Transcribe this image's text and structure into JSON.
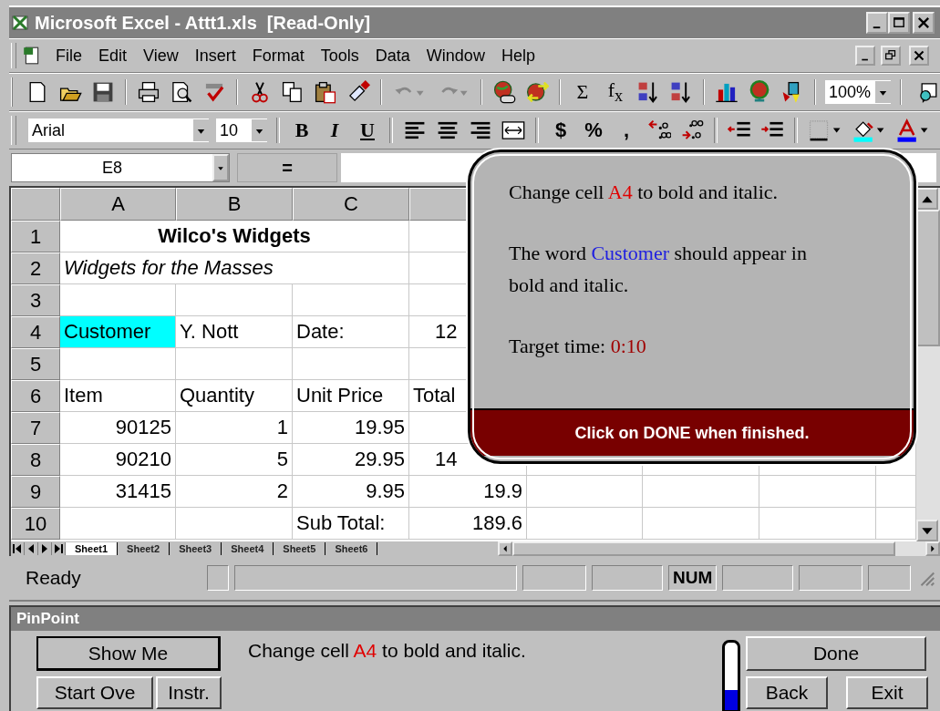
{
  "window": {
    "title": "Microsoft Excel - Attt1.xls  [Read-Only]"
  },
  "menu": [
    "File",
    "Edit",
    "View",
    "Insert",
    "Format",
    "Tools",
    "Data",
    "Window",
    "Help"
  ],
  "standard_toolbar": {
    "buttons": [
      {
        "label": "Σ"
      },
      {
        "label": "f$_{x}$"
      }
    ],
    "zoom": "100%"
  },
  "formatting_toolbar": {
    "font": "Arial",
    "size": "10",
    "buttons": [
      {
        "label": "B",
        "kind": "bold"
      },
      {
        "label": "I",
        "kind": "italic"
      },
      {
        "label": "U",
        "kind": "underline"
      }
    ],
    "number_buttons": [
      {
        "label": "$"
      },
      {
        "label": "%"
      },
      {
        "label": ","
      }
    ]
  },
  "formula_bar": {
    "name_box": "E8",
    "equals": "="
  },
  "sheet": {
    "columns": [
      "A",
      "B",
      "C"
    ],
    "rows": [
      {
        "label": "1",
        "cells": [
          {
            "text": "Wilco's Widgets",
            "kind": "title",
            "highlighted": false
          }
        ]
      },
      {
        "label": "2",
        "cells": [
          {
            "text": "Widgets for the Masses",
            "kind": "subtitle",
            "highlighted": false
          }
        ]
      },
      {
        "label": "3",
        "cells": []
      },
      {
        "label": "4",
        "cells": [
          {
            "text": "Customer",
            "kind": "text",
            "highlighted": true
          },
          {
            "text": "Y. Nott",
            "kind": "text",
            "highlighted": false
          },
          {
            "text": "Date:",
            "kind": "text",
            "highlighted": false
          },
          {
            "text": "12",
            "kind": "clipped",
            "highlighted": false
          }
        ]
      },
      {
        "label": "5",
        "cells": []
      },
      {
        "label": "6",
        "cells": [
          {
            "text": "Item",
            "kind": "text",
            "highlighted": false
          },
          {
            "text": "Quantity",
            "kind": "text",
            "highlighted": false
          },
          {
            "text": "Unit Price",
            "kind": "text",
            "highlighted": false
          },
          {
            "text": "Total",
            "kind": "text",
            "highlighted": false
          }
        ]
      },
      {
        "label": "7",
        "cells": [
          {
            "text": "90125",
            "kind": "number",
            "highlighted": false
          },
          {
            "text": "1",
            "kind": "number",
            "highlighted": false
          },
          {
            "text": "19.95",
            "kind": "number",
            "highlighted": false
          }
        ]
      },
      {
        "label": "8",
        "cells": [
          {
            "text": "90210",
            "kind": "number",
            "highlighted": false
          },
          {
            "text": "5",
            "kind": "number",
            "highlighted": false
          },
          {
            "text": "29.95",
            "kind": "number",
            "highlighted": false
          },
          {
            "text": "14",
            "kind": "clipped",
            "highlighted": false
          }
        ]
      },
      {
        "label": "9",
        "cells": [
          {
            "text": "31415",
            "kind": "number",
            "highlighted": false
          },
          {
            "text": "2",
            "kind": "number",
            "highlighted": false
          },
          {
            "text": "9.95",
            "kind": "number",
            "highlighted": false
          },
          {
            "text": "19.9",
            "kind": "number",
            "highlighted": false
          }
        ]
      },
      {
        "label": "10",
        "cells": [
          {
            "text": "",
            "kind": "text",
            "highlighted": false
          },
          {
            "text": "",
            "kind": "text",
            "highlighted": false
          },
          {
            "text": "Sub Total:",
            "kind": "text",
            "highlighted": false
          },
          {
            "text": "189.6",
            "kind": "number",
            "highlighted": false
          }
        ]
      }
    ]
  },
  "instruction_popup": {
    "paragraphs": [
      [
        {
          "text": "Change cell "
        },
        {
          "text": "A4",
          "color": "#e00000"
        },
        {
          "text": " to bold and italic."
        }
      ],
      [
        {
          "text": "The word "
        },
        {
          "text": "Customer",
          "color": "#2020e0"
        },
        {
          "text": " should appear in bold and italic."
        }
      ],
      [
        {
          "text": "Target time:  "
        },
        {
          "text": "0:10",
          "color": "#a00000"
        }
      ]
    ],
    "footer": "Click on DONE when finished."
  },
  "sheet_tabs": [
    {
      "label": "Sheet1",
      "selected": true
    },
    {
      "label": "Sheet2",
      "selected": false
    },
    {
      "label": "Sheet3",
      "selected": false
    },
    {
      "label": "Sheet4",
      "selected": false
    },
    {
      "label": "Sheet5",
      "selected": false
    },
    {
      "label": "Sheet6",
      "selected": false
    }
  ],
  "status_bar": {
    "mode": "Ready",
    "indicator": "NUM"
  },
  "pinpoint": {
    "title": "PinPoint",
    "show_me": "Show Me",
    "start_over": "Start Ove",
    "instructions": "Instr.",
    "message": [
      {
        "text": "Change cell "
      },
      {
        "text": "A4",
        "color": "#e00000"
      },
      {
        "text": " to bold and italic."
      }
    ],
    "progress": {
      "level": 0.3
    },
    "done": "Done",
    "back": "Back",
    "exit": "Exit"
  }
}
